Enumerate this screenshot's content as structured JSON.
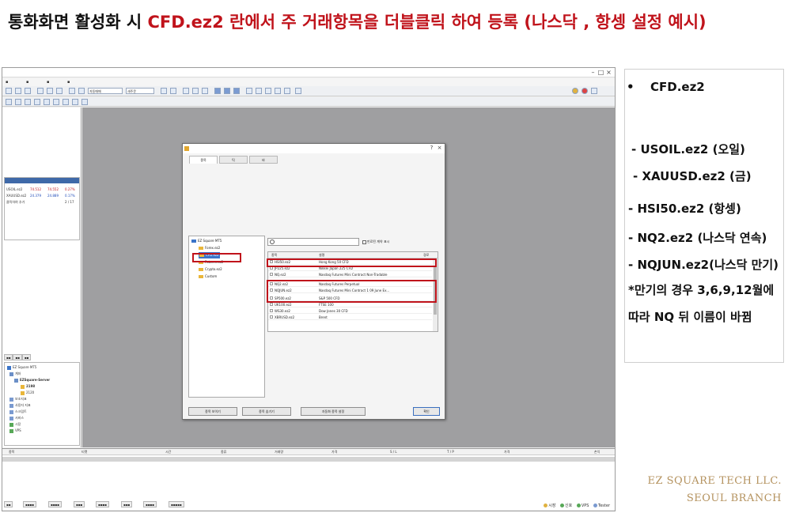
{
  "slide": {
    "title_black": "통화화면 활성화 시 ",
    "title_red": "CFD.ez2 란에서 주 거래항목을 더블클릭 하여 등록 (나스닥 , 항셍 설정 예시)"
  },
  "colors": {
    "title_red": "#c0131b",
    "highlight_box": "#c0131b",
    "workspace_bg": "#9f9fa1",
    "brand_gold": "#b4925e",
    "watch_header": "#3f69a8",
    "selection": "#3a74c9"
  },
  "platform": {
    "watchlist": {
      "rows": [
        {
          "c1": "USOIL.ez2",
          "c2": "74.512",
          "c3": "74.552",
          "c4": "0.27%"
        },
        {
          "c1": "XAUUSD.ez2",
          "c2": "24.379",
          "c3": "24.889",
          "c4": "0.17%"
        },
        {
          "c1": "클릭하여 추가",
          "c2": "",
          "c3": "",
          "c4": "2 / 17"
        }
      ]
    },
    "navigator": {
      "items": [
        "EZ Square MT5",
        "계좌",
        "EZSquare-Server",
        "2198",
        "2120",
        "보조지표",
        "사용자 지표",
        "스크립트",
        "서비스",
        "시장",
        "VPS"
      ]
    },
    "toolbar": {
      "algo_label": "자동매매",
      "new_order_label": "새주문"
    },
    "bottom": {
      "columns": [
        "종목",
        "티켓",
        "시간",
        "종류",
        "거래량",
        "가격",
        "S / L",
        "T / P",
        "가격",
        "손익"
      ],
      "status_items": [
        "시장",
        "신호",
        "VPS",
        "Tester"
      ]
    },
    "dialog": {
      "tabs": [
        "종목",
        "틱",
        "바"
      ],
      "tree": [
        "EZ Square MT5",
        "Forex.ez2",
        "CFD.ez2",
        "Futures.ez2",
        "Crypto.ez2",
        "Custom"
      ],
      "search_placeholder": "",
      "checkbox_label": "만료된 계약 표시",
      "grid_columns": [
        "종목",
        "설명",
        "경로"
      ],
      "rows": [
        {
          "symbol": "HSI50.ez2",
          "desc": "Hong Kong 50 CFD"
        },
        {
          "symbol": "JP225.ez2",
          "desc": "Nikkei Japan 225 CFD"
        },
        {
          "symbol": "NQ.ez2",
          "desc": "Nasdaq Futures Mini Contract Non-Tradable"
        },
        {
          "symbol": "NQ2.ez2",
          "desc": "Nasdaq Futures Perpetual"
        },
        {
          "symbol": "NQJUN.ez2",
          "desc": "Nasdaq Futures Mini Contract 1 09 June Ex..."
        },
        {
          "symbol": "SP500.ez2",
          "desc": "S&P 500 CFD"
        },
        {
          "symbol": "UK100.ez2",
          "desc": "FTSE 100"
        },
        {
          "symbol": "WS30.ez2",
          "desc": "Dow Jones 30 CFD"
        },
        {
          "symbol": "XBRUSD.ez2",
          "desc": "Brent"
        }
      ],
      "buttons": [
        "종목 보이기",
        "종목 숨기기",
        "자동화 종목 설정",
        "확인"
      ]
    }
  },
  "notes": {
    "bullet": "•",
    "heading": "CFD.ez2",
    "lines": [
      "- USOIL.ez2 (오일)",
      "- XAUUSD.ez2 (금)",
      "- HSI50.ez2 (항셍)",
      "- NQ2.ez2 (나스닥 연속)",
      "- NQJUN.ez2(나스닥 만기)",
      "*만기의 경우 3,6,9,12월에",
      "따라 NQ 뒤 이름이 바뀜"
    ]
  },
  "brand": {
    "line1": "EZ SQUARE TECH LLC.",
    "line2": "SEOUL BRANCH"
  }
}
